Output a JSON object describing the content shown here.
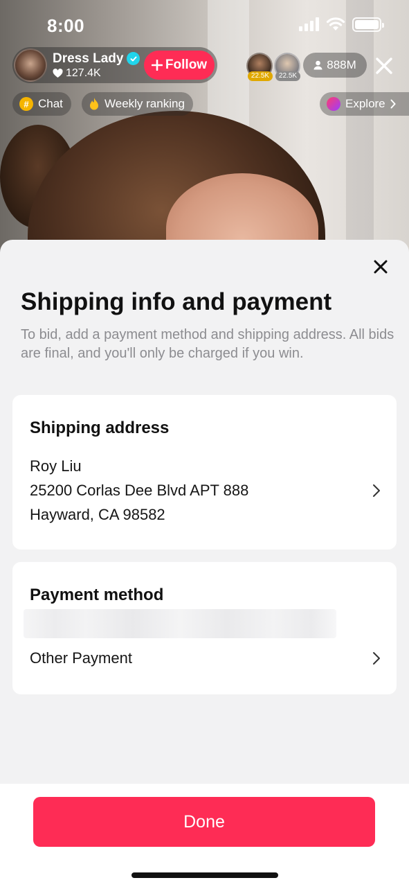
{
  "status_bar": {
    "time": "8:00"
  },
  "live": {
    "host": {
      "name": "Dress Lady",
      "likes": "127.4K",
      "follow_label": "Follow"
    },
    "viewers": [
      {
        "badge": "22.5K",
        "badge_color": "#e0a800"
      },
      {
        "badge": "22.5K",
        "badge_color": "#8a8a8a"
      }
    ],
    "viewer_count": "888M",
    "chips": {
      "chat": "Chat",
      "weekly_ranking": "Weekly ranking",
      "explore": "Explore"
    }
  },
  "sheet": {
    "title": "Shipping info and payment",
    "description": "To bid, add a payment method and shipping address. All bids are final, and you'll only be charged if you win.",
    "shipping": {
      "title": "Shipping address",
      "name": "Roy Liu",
      "street": "25200 Corlas Dee Blvd APT 888",
      "city": "Hayward, CA 98582"
    },
    "payment": {
      "title": "Payment method",
      "option": "Other Payment"
    },
    "done_label": "Done"
  },
  "colors": {
    "accent": "#fe2c55",
    "verified": "#20d5ec"
  }
}
